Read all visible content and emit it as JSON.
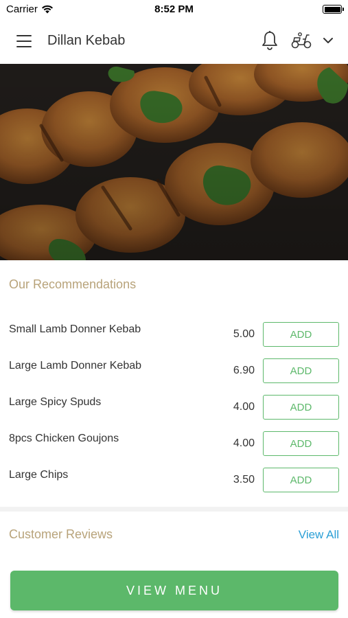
{
  "status_bar": {
    "carrier": "Carrier",
    "time": "8:52 PM"
  },
  "navbar": {
    "title": "Dillan Kebab"
  },
  "hero": {
    "image_alt": "Chicken kebab skewers with coriander"
  },
  "recommendations": {
    "title": "Our Recommendations",
    "items": [
      {
        "name": "Small Lamb Donner Kebab",
        "price": "5.00",
        "button": "ADD"
      },
      {
        "name": "Large Lamb Donner Kebab",
        "price": "6.90",
        "button": "ADD"
      },
      {
        "name": "Large Spicy Spuds",
        "price": "4.00",
        "button": "ADD"
      },
      {
        "name": "8pcs Chicken Goujons",
        "price": "4.00",
        "button": "ADD"
      },
      {
        "name": "Large Chips",
        "price": "3.50",
        "button": "ADD"
      }
    ]
  },
  "reviews": {
    "title": "Customer Reviews",
    "view_all": "View All"
  },
  "cta": {
    "label": "VIEW MENU"
  },
  "colors": {
    "accent_green": "#5cb86a",
    "section_gold": "#b8a37a",
    "link_blue": "#2a9fd6"
  }
}
